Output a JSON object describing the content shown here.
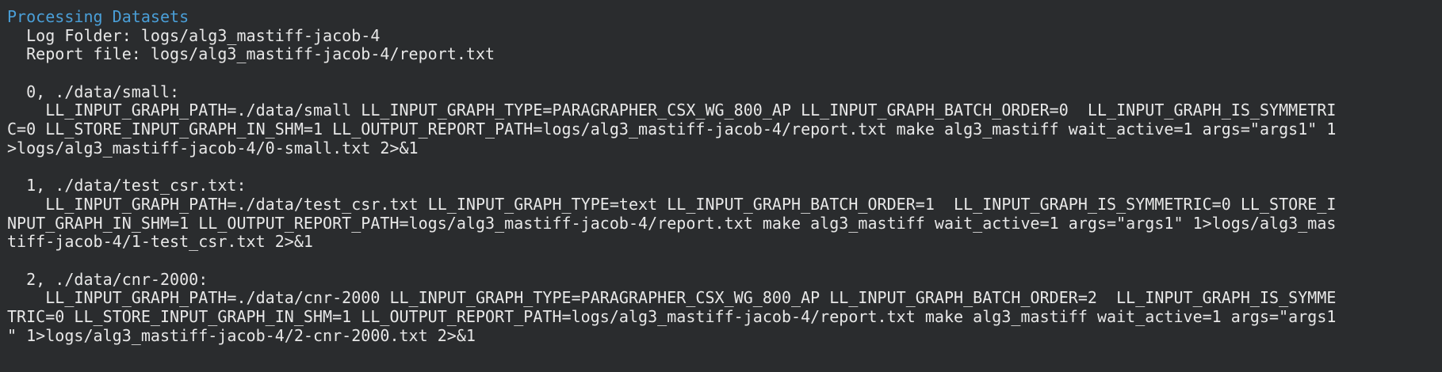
{
  "colors": {
    "background": "#2a2c2e",
    "foreground": "#e8e8e8",
    "heading": "#4a9fd8"
  },
  "header": {
    "title": "Processing Datasets",
    "log_folder": "  Log Folder: logs/alg3_mastiff-jacob-4",
    "report_file": "  Report file: logs/alg3_mastiff-jacob-4/report.txt"
  },
  "datasets": [
    {
      "heading": "  0, ./data/small:",
      "lines": [
        "    LL_INPUT_GRAPH_PATH=./data/small LL_INPUT_GRAPH_TYPE=PARAGRAPHER_CSX_WG_800_AP LL_INPUT_GRAPH_BATCH_ORDER=0  LL_INPUT_GRAPH_IS_SYMMETRI",
        "C=0 LL_STORE_INPUT_GRAPH_IN_SHM=1 LL_OUTPUT_REPORT_PATH=logs/alg3_mastiff-jacob-4/report.txt make alg3_mastiff wait_active=1 args=\"args1\" 1",
        ">logs/alg3_mastiff-jacob-4/0-small.txt 2>&1"
      ]
    },
    {
      "heading": "  1, ./data/test_csr.txt:",
      "lines": [
        "    LL_INPUT_GRAPH_PATH=./data/test_csr.txt LL_INPUT_GRAPH_TYPE=text LL_INPUT_GRAPH_BATCH_ORDER=1  LL_INPUT_GRAPH_IS_SYMMETRIC=0 LL_STORE_I",
        "NPUT_GRAPH_IN_SHM=1 LL_OUTPUT_REPORT_PATH=logs/alg3_mastiff-jacob-4/report.txt make alg3_mastiff wait_active=1 args=\"args1\" 1>logs/alg3_mas",
        "tiff-jacob-4/1-test_csr.txt 2>&1"
      ]
    },
    {
      "heading": "  2, ./data/cnr-2000:",
      "lines": [
        "    LL_INPUT_GRAPH_PATH=./data/cnr-2000 LL_INPUT_GRAPH_TYPE=PARAGRAPHER_CSX_WG_800_AP LL_INPUT_GRAPH_BATCH_ORDER=2  LL_INPUT_GRAPH_IS_SYMME",
        "TRIC=0 LL_STORE_INPUT_GRAPH_IN_SHM=1 LL_OUTPUT_REPORT_PATH=logs/alg3_mastiff-jacob-4/report.txt make alg3_mastiff wait_active=1 args=\"args1",
        "\" 1>logs/alg3_mastiff-jacob-4/2-cnr-2000.txt 2>&1"
      ]
    }
  ]
}
